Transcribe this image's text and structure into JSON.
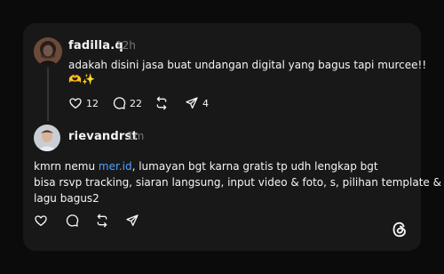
{
  "posts": [
    {
      "username": "fadilla.q",
      "time": "12h",
      "text_lines": [
        "adakah disini jasa buat undangan digital yang bagus tapi murcee!!"
      ],
      "emoji_line": "🫶✨",
      "likes": "12",
      "comments": "22",
      "shares": "4"
    },
    {
      "username": "rievandrst",
      "time": "1m",
      "line1_prefix": "kmrn nemu ",
      "line1_link": "mer.id",
      "line1_suffix": ", lumayan bgt karna gratis tp udh lengkap bgt",
      "line2": "bisa rsvp tracking, siaran langsung, input video & foto, s, pilihan template &",
      "line3": "lagu bagus2"
    }
  ],
  "icons": [
    "heart-icon",
    "comment-icon",
    "repost-icon",
    "share-icon",
    "threads-logo-icon"
  ],
  "colors": {
    "background": "#0b0b0b",
    "card": "#181818",
    "link": "#4da3ff",
    "muted": "#777777"
  }
}
